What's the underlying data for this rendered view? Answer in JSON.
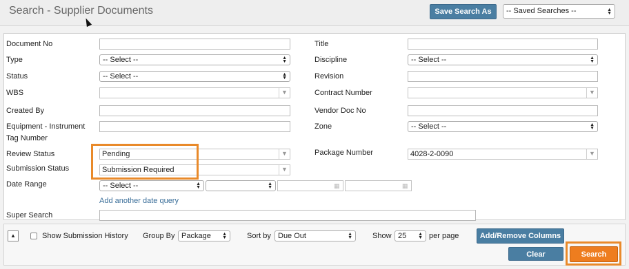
{
  "header": {
    "title": "Search - Supplier Documents",
    "save_search": "Save Search As",
    "saved_searches": "-- Saved Searches --"
  },
  "form": {
    "document_no": {
      "label": "Document No",
      "value": ""
    },
    "title": {
      "label": "Title",
      "value": ""
    },
    "type": {
      "label": "Type",
      "value": "-- Select --"
    },
    "discipline": {
      "label": "Discipline",
      "value": "-- Select --"
    },
    "status": {
      "label": "Status",
      "value": "-- Select --"
    },
    "revision": {
      "label": "Revision",
      "value": ""
    },
    "wbs": {
      "label": "WBS",
      "value": ""
    },
    "contract_number": {
      "label": "Contract Number",
      "value": ""
    },
    "created_by": {
      "label": "Created By",
      "value": ""
    },
    "vendor_doc_no": {
      "label": "Vendor Doc No",
      "value": ""
    },
    "equipment_tag": {
      "label_line1": "Equipment - Instrument",
      "label_line2": "Tag Number",
      "value": ""
    },
    "zone": {
      "label": "Zone",
      "value": "-- Select --"
    },
    "review_status": {
      "label": "Review Status",
      "value": "Pending"
    },
    "package_number": {
      "label": "Package Number",
      "value": "4028-2-0090"
    },
    "submission_status": {
      "label": "Submission Status",
      "value": "Submission Required"
    },
    "date_range": {
      "label": "Date Range",
      "value": "-- Select --",
      "second": ""
    },
    "add_date_query": "Add another date query",
    "super_search": {
      "label": "Super Search",
      "value": ""
    }
  },
  "footer": {
    "collapse_icon": "triangle-up-icon",
    "show_history": "Show Submission History",
    "group_by_label": "Group By",
    "group_by_value": "Package",
    "sort_by_label": "Sort by",
    "sort_by_value": "Due Out",
    "show_label": "Show",
    "show_value": "25",
    "per_page": "per page",
    "add_remove_columns": "Add/Remove Columns",
    "clear": "Clear",
    "search": "Search"
  },
  "colors": {
    "accent_blue": "#4a7ea2",
    "highlight_orange": "#e98a2a",
    "search_orange": "#ee7d1f"
  }
}
